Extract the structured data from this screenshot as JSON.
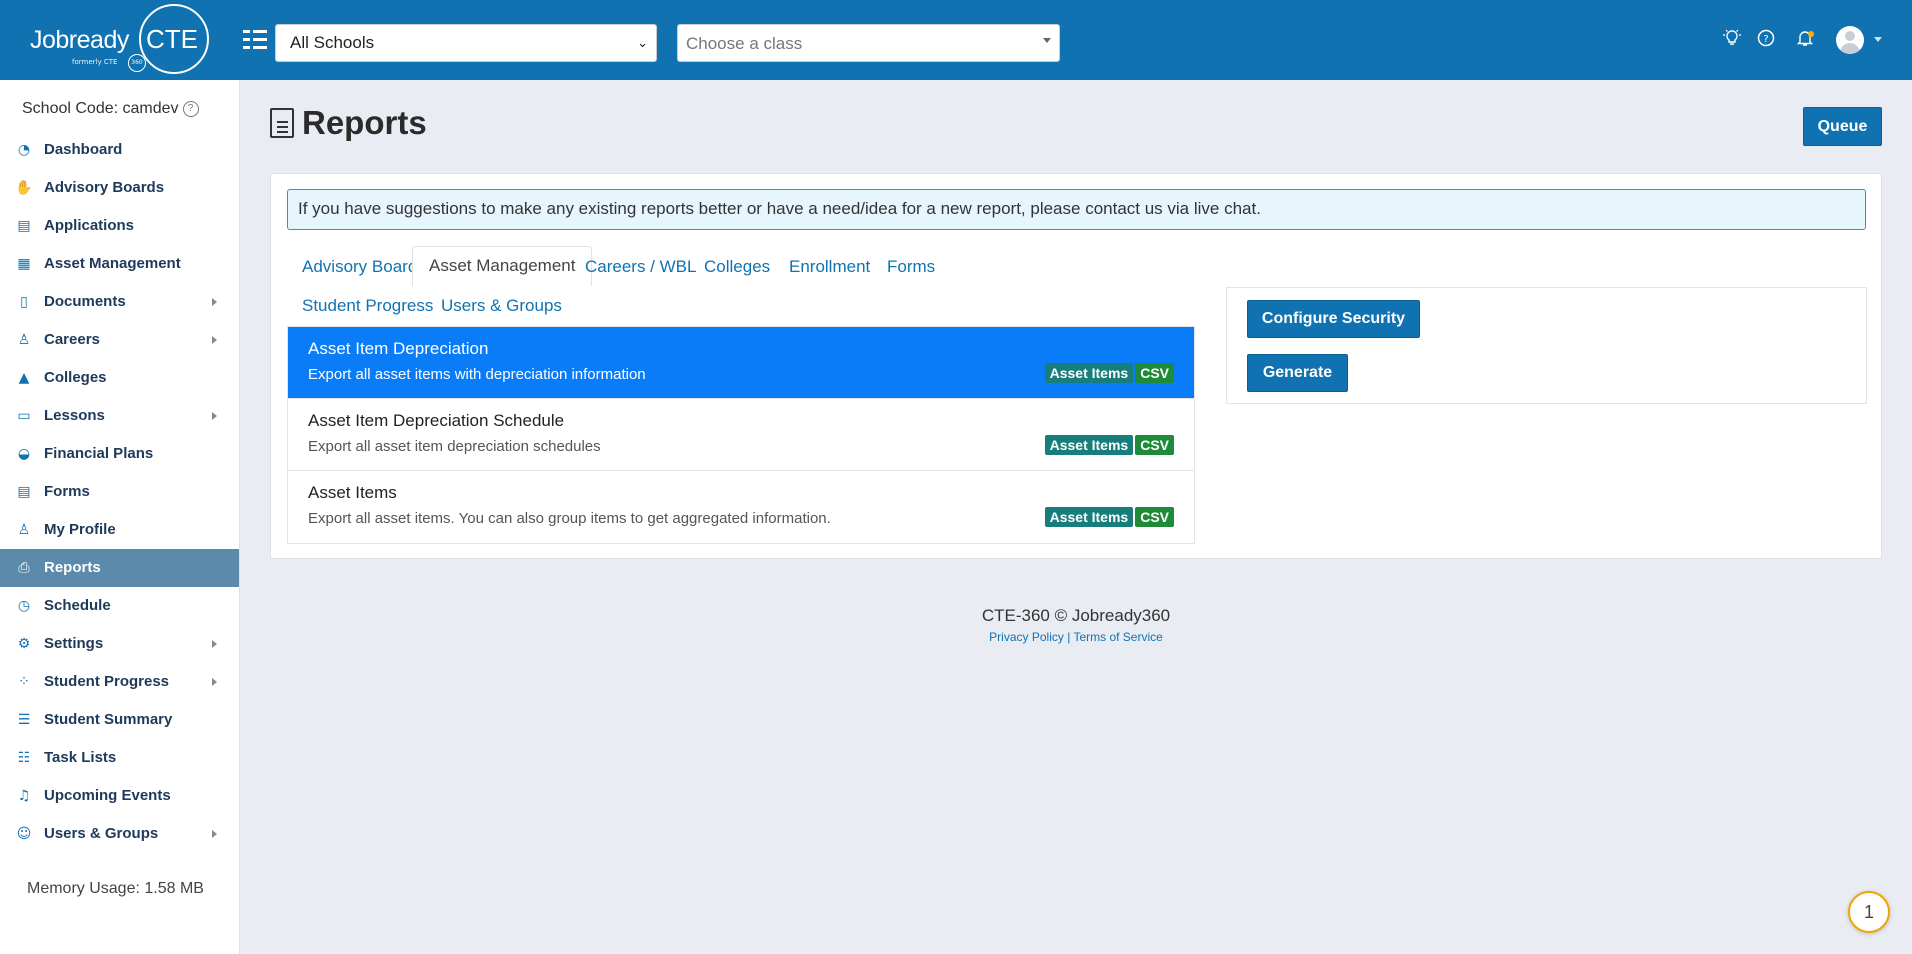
{
  "header": {
    "logo_wordmark": "Jobready",
    "logo_cte": "CTE",
    "logo_sub": "formerly CTE",
    "logo_mini": "360",
    "school_select": {
      "value": "All Schools"
    },
    "class_select": {
      "placeholder": "Choose a class"
    },
    "icons": [
      "lightbulb-icon",
      "help-icon",
      "bell-icon",
      "user-avatar"
    ]
  },
  "sidebar": {
    "school_code": "School Code: camdev",
    "items": [
      {
        "label": "Dashboard",
        "icon": "dashboard-icon",
        "glyph": "◔",
        "has_children": false,
        "active": false
      },
      {
        "label": "Advisory Boards",
        "icon": "handshake-icon",
        "glyph": "✋",
        "has_children": false,
        "active": false
      },
      {
        "label": "Applications",
        "icon": "application-icon",
        "glyph": "▤",
        "has_children": false,
        "active": false
      },
      {
        "label": "Asset Management",
        "icon": "asset-icon",
        "glyph": "▦",
        "has_children": false,
        "active": false
      },
      {
        "label": "Documents",
        "icon": "document-icon",
        "glyph": "▯",
        "has_children": true,
        "active": false
      },
      {
        "label": "Careers",
        "icon": "careers-icon",
        "glyph": "♙",
        "has_children": true,
        "active": false
      },
      {
        "label": "Colleges",
        "icon": "graduation-cap-icon",
        "glyph": "▲",
        "has_children": false,
        "active": false
      },
      {
        "label": "Lessons",
        "icon": "lessons-icon",
        "glyph": "▭",
        "has_children": true,
        "active": false
      },
      {
        "label": "Financial Plans",
        "icon": "piggy-bank-icon",
        "glyph": "◒",
        "has_children": false,
        "active": false
      },
      {
        "label": "Forms",
        "icon": "forms-icon",
        "glyph": "▤",
        "has_children": false,
        "active": false
      },
      {
        "label": "My Profile",
        "icon": "profile-icon",
        "glyph": "♙",
        "has_children": false,
        "active": false
      },
      {
        "label": "Reports",
        "icon": "printer-icon",
        "glyph": "⎙",
        "has_children": false,
        "active": true
      },
      {
        "label": "Schedule",
        "icon": "clock-icon",
        "glyph": "◷",
        "has_children": false,
        "active": false
      },
      {
        "label": "Settings",
        "icon": "gear-icon",
        "glyph": "⚙",
        "has_children": true,
        "active": false
      },
      {
        "label": "Student Progress",
        "icon": "progress-icon",
        "glyph": "⁘",
        "has_children": true,
        "active": false
      },
      {
        "label": "Student Summary",
        "icon": "checklist-icon",
        "glyph": "☰",
        "has_children": false,
        "active": false
      },
      {
        "label": "Task Lists",
        "icon": "list-icon",
        "glyph": "☷",
        "has_children": false,
        "active": false
      },
      {
        "label": "Upcoming Events",
        "icon": "bell-icon",
        "glyph": "♫",
        "has_children": false,
        "active": false
      },
      {
        "label": "Users & Groups",
        "icon": "users-icon",
        "glyph": "☺",
        "has_children": true,
        "active": false
      }
    ],
    "memory_usage": "Memory Usage: 1.58 MB"
  },
  "main": {
    "title": "Reports",
    "queue_label": "Queue",
    "alert": "If you have suggestions to make any existing reports better or have a need/idea for a new report, please contact us via live chat.",
    "tabs": [
      {
        "label": "Advisory Board",
        "active": false
      },
      {
        "label": "Asset Management",
        "active": true
      },
      {
        "label": "Careers / WBL",
        "active": false
      },
      {
        "label": "Colleges",
        "active": false
      },
      {
        "label": "Enrollment",
        "active": false
      },
      {
        "label": "Forms",
        "active": false
      },
      {
        "label": "Student Progress",
        "active": false
      },
      {
        "label": "Users & Groups",
        "active": false
      }
    ],
    "reports": [
      {
        "title": "Asset Item Depreciation",
        "description": "Export all asset items with depreciation information",
        "category": "Asset Items",
        "format": "CSV",
        "selected": true
      },
      {
        "title": "Asset Item Depreciation Schedule",
        "description": "Export all asset item depreciation schedules",
        "category": "Asset Items",
        "format": "CSV",
        "selected": false
      },
      {
        "title": "Asset Items",
        "description": "Export all asset items. You can also group items to get aggregated information.",
        "category": "Asset Items",
        "format": "CSV",
        "selected": false
      }
    ],
    "configure_security_label": "Configure Security",
    "generate_label": "Generate"
  },
  "footer": {
    "copyright": "CTE-360 © Jobready360",
    "privacy": "Privacy Policy",
    "separator": "|",
    "terms": "Terms of Service"
  },
  "chat": {
    "count": "1"
  },
  "colors": {
    "brand": "#1172b1",
    "selected": "#0a7cf7",
    "active_nav": "#5b8aab",
    "badge_category": "#177e7c",
    "badge_format": "#1f8a37"
  }
}
